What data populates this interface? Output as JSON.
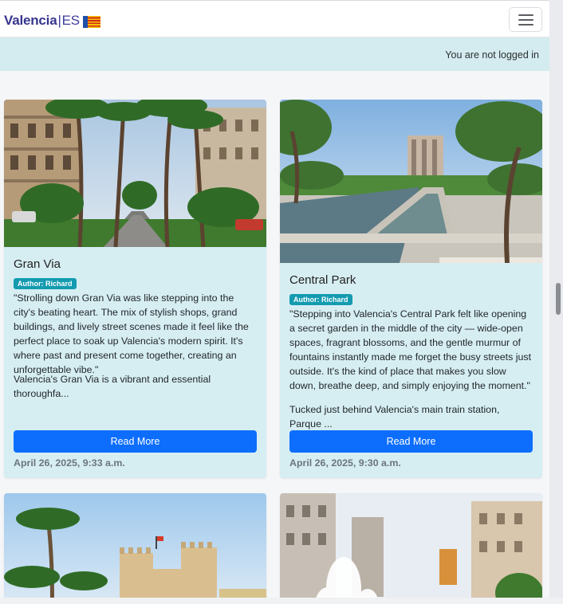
{
  "brand": {
    "name": "Valencia",
    "separator": "|",
    "lang": "ES",
    "flag": "valencian-flag"
  },
  "nav": {
    "toggler_icon": "hamburger-icon"
  },
  "login": {
    "status": "You are not logged in"
  },
  "posts": [
    {
      "title": "Gran Via",
      "author": "Author: Richard",
      "quote": "\"Strolling down Gran Via was like stepping into the city's beating heart. The mix of stylish shops, grand buildings, and lively street scenes made it feel like the perfect place to soak up Valencia's modern spirit. It's where past and present come together, creating an unforgettable vibe.\"",
      "excerpt": "Valencia's Gran Via is a vibrant and essential thoroughfa...",
      "button": "Read More",
      "date": "April 26, 2025, 9:33 a.m."
    },
    {
      "title": "Central Park",
      "author": "Author: Richard",
      "quote": "\"Stepping into Valencia's Central Park felt like opening a secret garden in the middle of the city — wide-open spaces, fragrant blossoms, and the gentle murmur of fountains instantly made me forget the busy streets just outside. It's the kind of place that makes you slow down, breathe deep, and simply enjoying the moment.\"",
      "excerpt": "Tucked just behind Valencia's main train station, Parque ...",
      "button": "Read More",
      "date": "April 26, 2025, 9:30 a.m."
    }
  ],
  "colors": {
    "accent": "#0d6efd",
    "card_bg": "#d6eef2",
    "badge": "#149bb0",
    "brand": "#36358f"
  }
}
